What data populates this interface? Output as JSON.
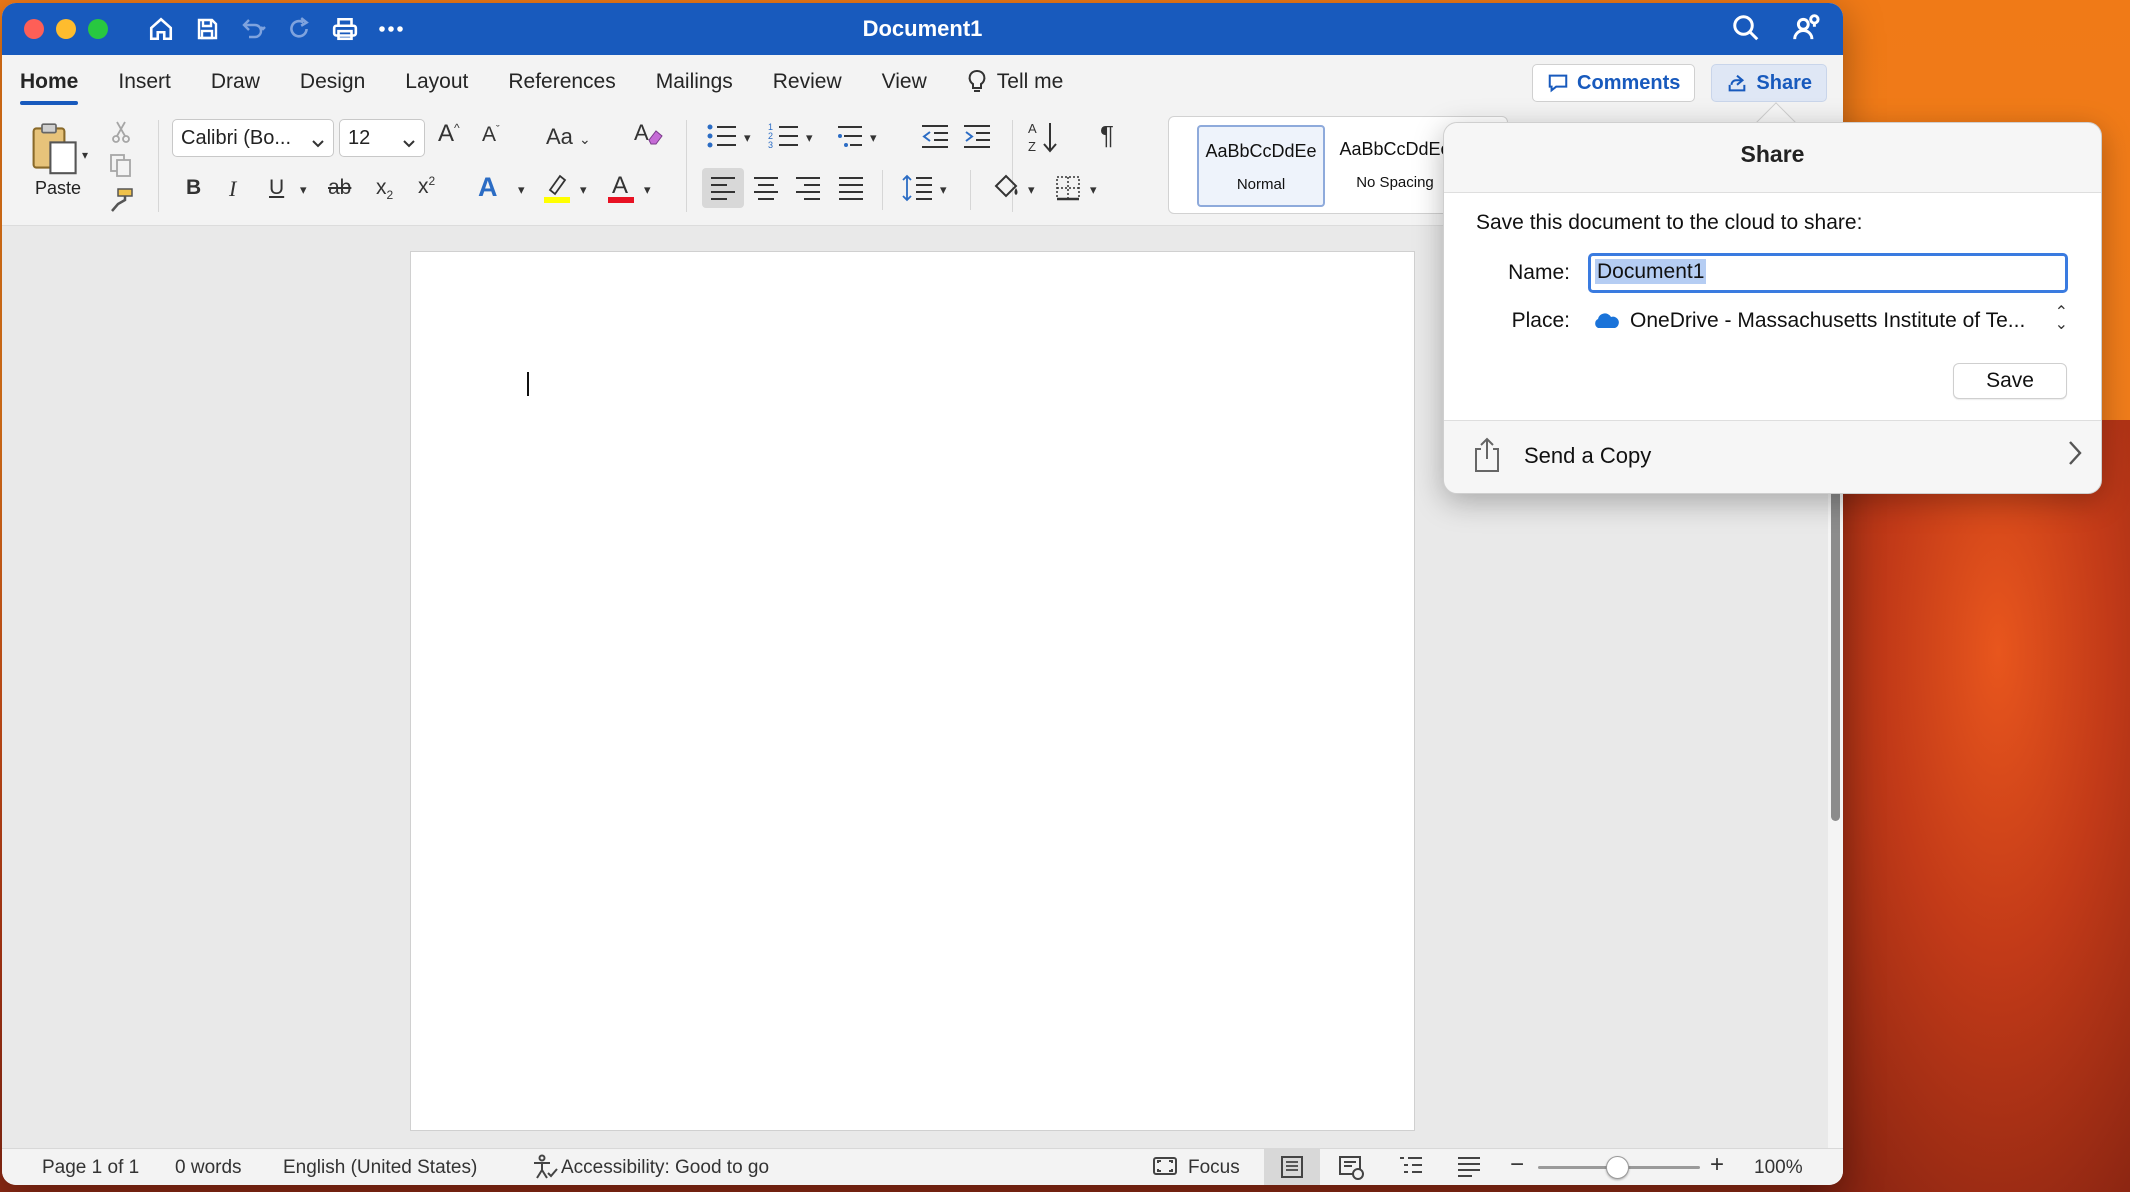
{
  "window": {
    "title": "Document1"
  },
  "tabs": [
    "Home",
    "Insert",
    "Draw",
    "Design",
    "Layout",
    "References",
    "Mailings",
    "Review",
    "View"
  ],
  "tell_me": "Tell me",
  "header_buttons": {
    "comments": "Comments",
    "share": "Share"
  },
  "ribbon": {
    "paste": "Paste",
    "font_name": "Calibri (Bo...",
    "font_size": "12",
    "change_case": "Aa",
    "styles": [
      {
        "sample": "AaBbCcDdEe",
        "name": "Normal"
      },
      {
        "sample": "AaBbCcDdEe",
        "name": "No Spacing"
      }
    ]
  },
  "share_popover": {
    "title": "Share",
    "lead": "Save this document to the cloud to share:",
    "name_label": "Name:",
    "name_value": "Document1",
    "place_label": "Place:",
    "place_value": "OneDrive - Massachusetts Institute of Te...",
    "save": "Save",
    "send_copy": "Send a Copy"
  },
  "status": {
    "page": "Page 1 of 1",
    "words": "0 words",
    "language": "English (United States)",
    "accessibility": "Accessibility: Good to go",
    "focus": "Focus",
    "zoom": "100%"
  },
  "colors": {
    "brand": "#185abd",
    "highlight": "#ffff00",
    "font_color": "#e81123"
  }
}
